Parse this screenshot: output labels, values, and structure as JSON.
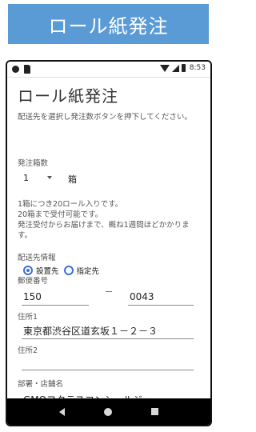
{
  "banner": {
    "title": "ロール紙発注"
  },
  "status_bar": {
    "time": "8:53"
  },
  "screen": {
    "title": "ロール紙発注",
    "instruction": "配送先を選択し発注数ボタンを押下してください。",
    "quantity": {
      "label": "発注箱数",
      "value": "1",
      "unit": "箱"
    },
    "notes": [
      "1箱につき20ロール入りです。",
      "20箱まで受付可能です。",
      "発注受付からお届けまで、概ね1週間ほどかかります。"
    ],
    "delivery": {
      "label": "配送先情報",
      "options": [
        {
          "label": "設置先",
          "selected": true
        },
        {
          "label": "指定先",
          "selected": false
        }
      ]
    },
    "postal": {
      "label": "郵便番号",
      "first": "150",
      "second": "0043"
    },
    "address1": {
      "label": "住所1",
      "value": "東京都渋谷区道玄坂１－２－３"
    },
    "address2": {
      "label": "住所2",
      "value": ""
    },
    "dept": {
      "label": "部署・店舗名",
      "value": "GMOフクラスコンシェルジュ"
    }
  },
  "icons": {
    "nav_back": "back-icon",
    "nav_home": "home-icon",
    "nav_recent": "recent-apps-icon"
  },
  "colors": {
    "banner": "#5b9bd5",
    "radio_accent": "#3b6fd3",
    "navbar": "#000000"
  }
}
